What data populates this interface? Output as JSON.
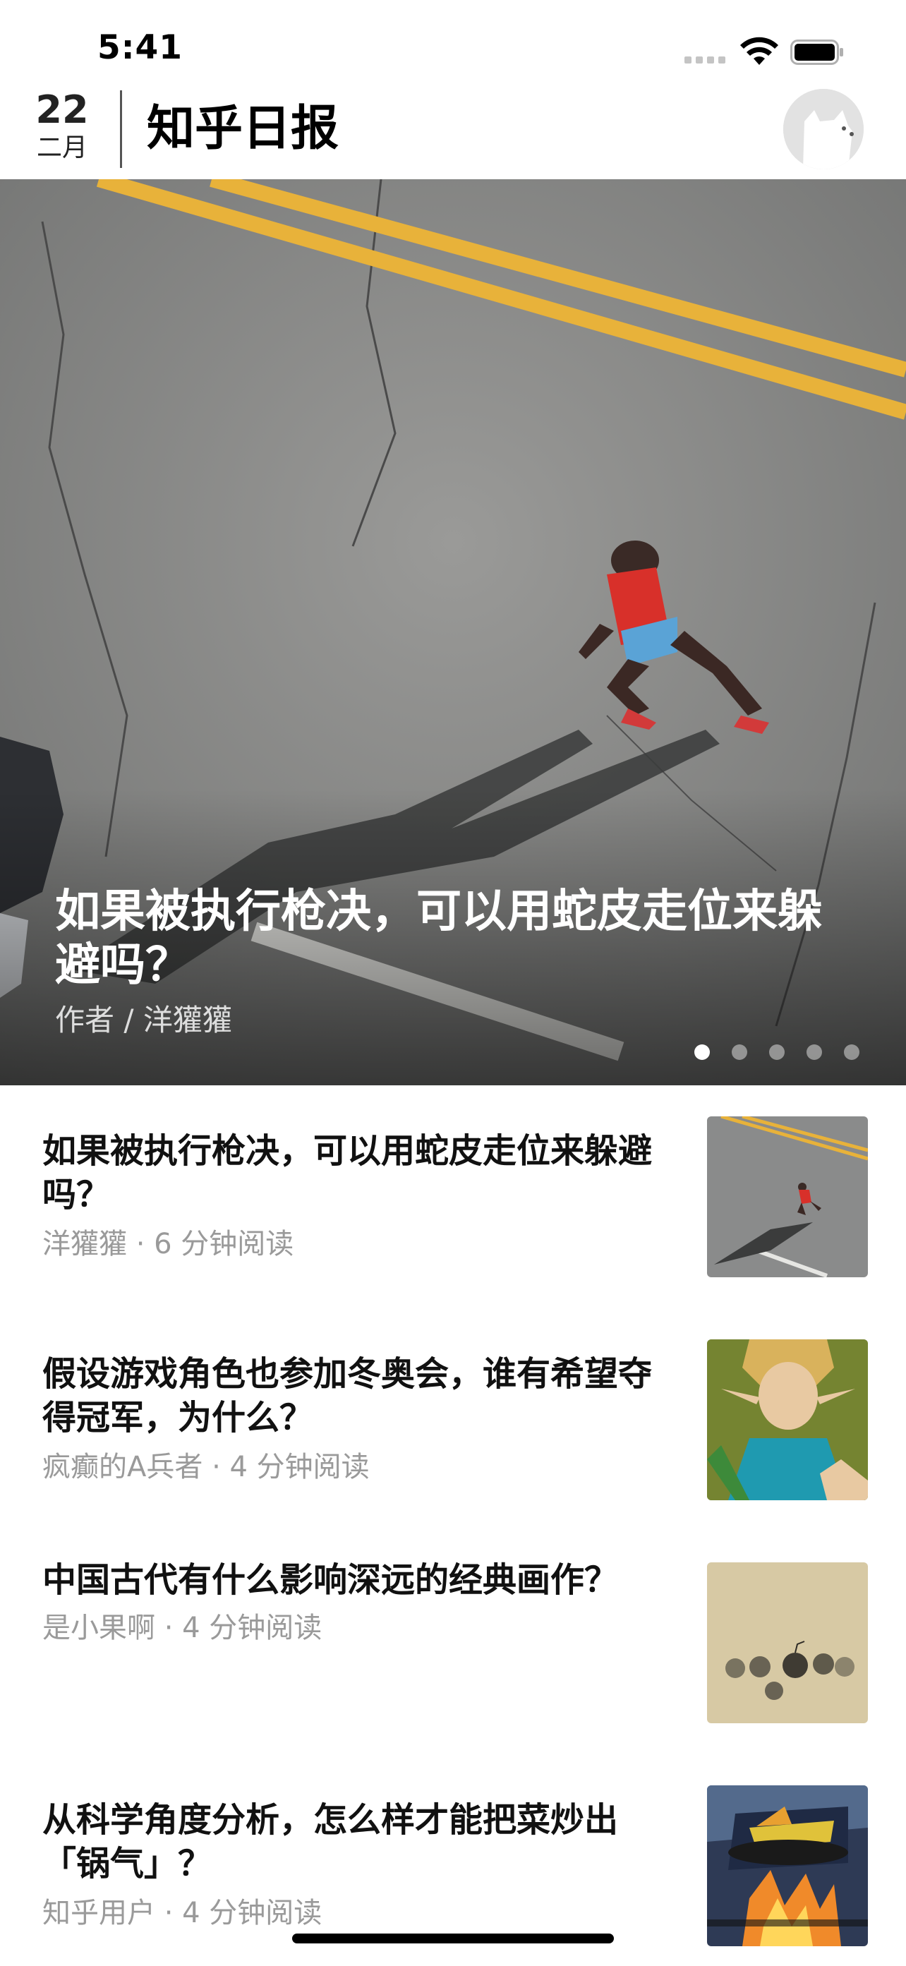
{
  "status_bar": {
    "time": "5:41"
  },
  "header": {
    "day": "22",
    "month": "二月",
    "app_title": "知乎日报"
  },
  "hero": {
    "title": "如果被执行枪决，可以用蛇皮走位来躲避吗？",
    "author": "作者 / 洋獾獾",
    "pages": 5,
    "active_page": 0
  },
  "stories": [
    {
      "title": "如果被执行枪决，可以用蛇皮走位来躲避吗？",
      "hint": "洋獾獾 · 6 分钟阅读",
      "thumb": "running-road-thumbnail"
    },
    {
      "title": "假设游戏角色也参加冬奥会，谁有希望夺得冠军，为什么？",
      "hint": "疯癫的A兵者 · 4 分钟阅读",
      "thumb": "game-character-thumbnail"
    },
    {
      "title": "中国古代有什么影响深远的经典画作？",
      "hint": "是小果啊 · 4 分钟阅读",
      "thumb": "ancient-painting-thumbnail"
    },
    {
      "title": "从科学角度分析，怎么样才能把菜炒出「锅气」？",
      "hint": "知乎用户 · 4 分钟阅读",
      "thumb": "wok-cooking-thumbnail"
    }
  ],
  "colors": {
    "road": "#8d8d8d",
    "road_line": "#e8b23a",
    "hint": "#9a9a9a"
  }
}
